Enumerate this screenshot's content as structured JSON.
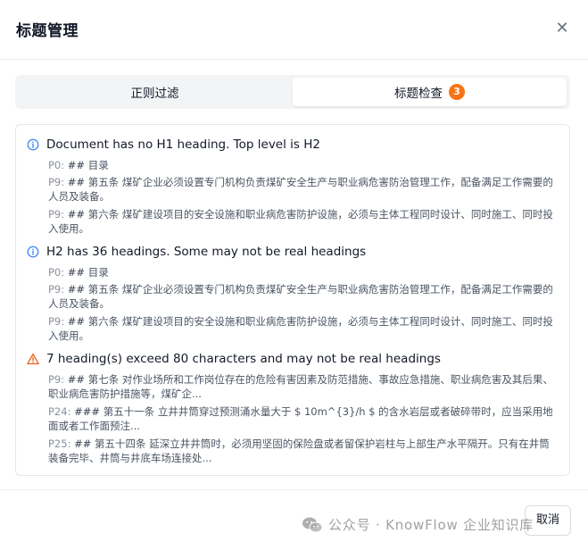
{
  "dialog": {
    "title": "标题管理",
    "close_glyph": "✕",
    "cancel_label": "取消"
  },
  "tabs": [
    {
      "label": "正则过滤",
      "active": false
    },
    {
      "label": "标题检查",
      "active": true,
      "badge": "3"
    }
  ],
  "issues": [
    {
      "icon": "info-icon",
      "title": "Document has no H1 heading. Top level is H2",
      "items": [
        {
          "prefix": "P0:",
          "hashes": "##",
          "text": "目录"
        },
        {
          "prefix": "P9:",
          "hashes": "##",
          "text": "第五条 煤矿企业必须设置专门机构负责煤矿安全生产与职业病危害防治管理工作，配备满足工作需要的人员及装备。"
        },
        {
          "prefix": "P9:",
          "hashes": "##",
          "text": "第六条 煤矿建设项目的安全设施和职业病危害防护设施，必须与主体工程同时设计、同时施工、同时投入使用。"
        }
      ]
    },
    {
      "icon": "info-icon",
      "title": "H2 has 36 headings. Some may not be real headings",
      "items": [
        {
          "prefix": "P0:",
          "hashes": "##",
          "text": "目录"
        },
        {
          "prefix": "P9:",
          "hashes": "##",
          "text": "第五条 煤矿企业必须设置专门机构负责煤矿安全生产与职业病危害防治管理工作，配备满足工作需要的人员及装备。"
        },
        {
          "prefix": "P9:",
          "hashes": "##",
          "text": "第六条 煤矿建设项目的安全设施和职业病危害防护设施，必须与主体工程同时设计、同时施工、同时投入使用。"
        }
      ]
    },
    {
      "icon": "warning-icon",
      "title": "7 heading(s) exceed 80 characters and may not be real headings",
      "items": [
        {
          "prefix": "P9:",
          "hashes": "##",
          "text": "第七条 对作业场所和工作岗位存在的危险有害因素及防范措施、事故应急措施、职业病危害及其后果、职业病危害防护措施等，煤矿企..."
        },
        {
          "prefix": "P24:",
          "hashes": "###",
          "text": "第五十一条 立井井筒穿过预测涌水量大于 $ 10m^{3}/h $ 的含水岩层或者破碎带时，应当采用地面或者工作面预注..."
        },
        {
          "prefix": "P25:",
          "hashes": "##",
          "text": "第五十四条 延深立井井筒时，必须用坚固的保险盘或者留保护岩柱与上部生产水平隔开。只有在井筒装备完毕、井筒与井底车场连接处..."
        }
      ]
    }
  ],
  "watermark": {
    "icon": "wechat-icon",
    "text": "公众号 · KnowFlow 企业知识库"
  },
  "colors": {
    "info": "#3b82f6",
    "warning": "#ea580c",
    "badge": "#f97316"
  }
}
